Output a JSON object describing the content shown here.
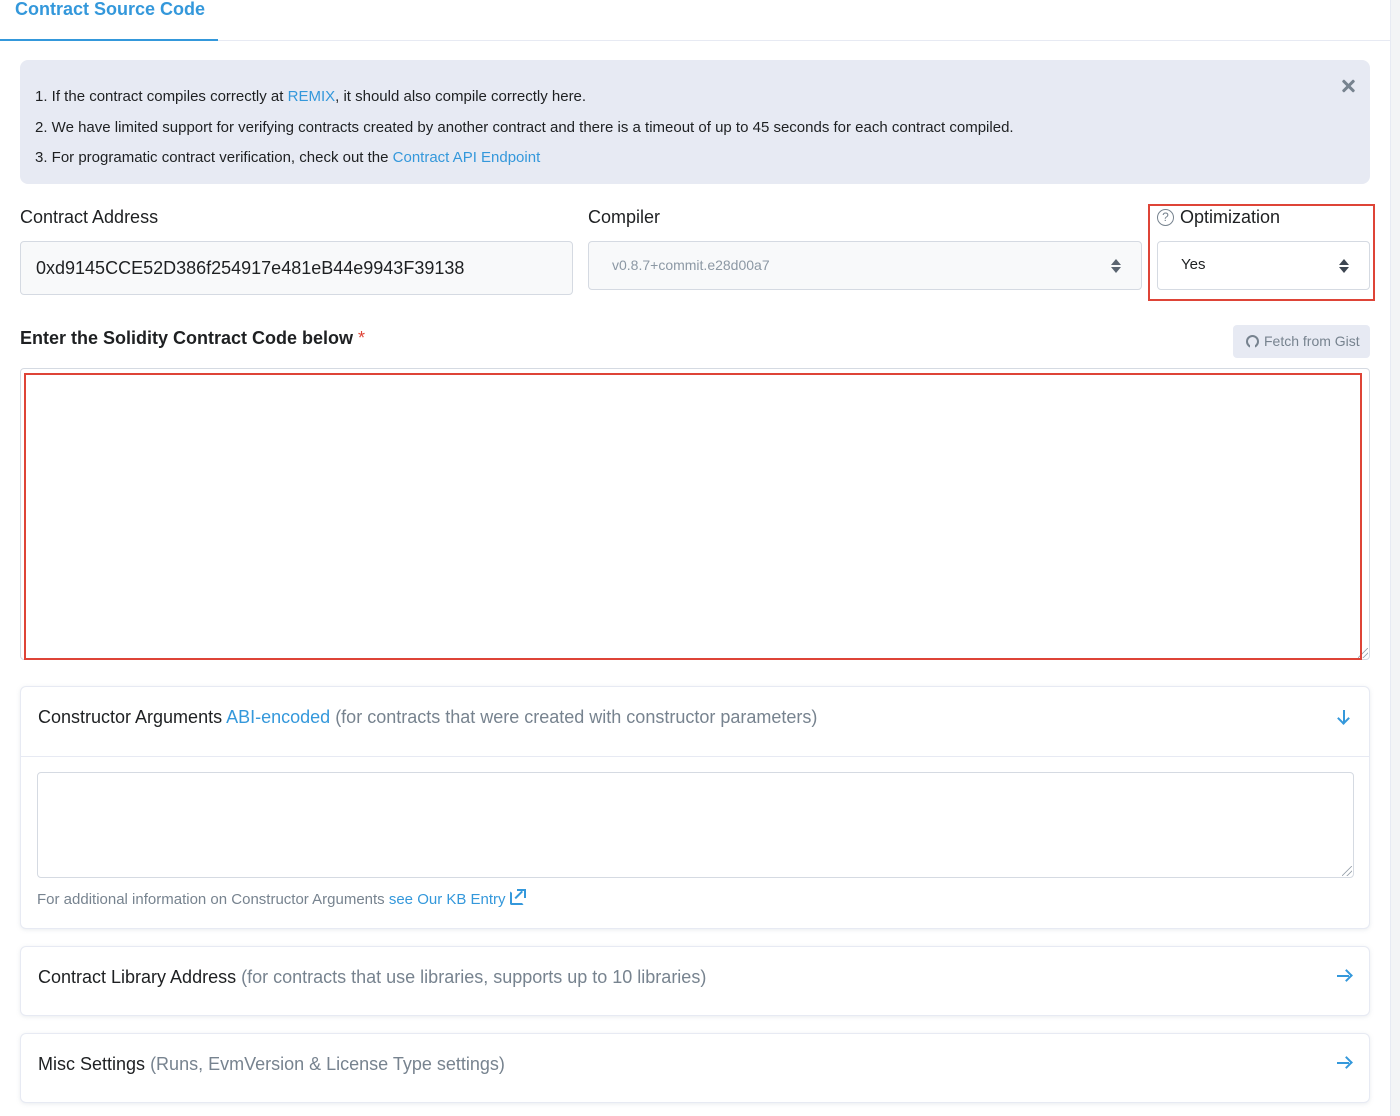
{
  "tabs": {
    "active_label": "Contract Source Code"
  },
  "alert": {
    "line1_prefix": "1. If the contract compiles correctly at ",
    "line1_link": "REMIX",
    "line1_suffix": ", it should also compile correctly here.",
    "line2": "2. We have limited support for verifying contracts created by another contract and there is a timeout of up to 45 seconds for each contract compiled.",
    "line3_prefix": "3. For programatic contract verification, check out the ",
    "line3_link": "Contract API Endpoint",
    "close_icon": "close-icon"
  },
  "form": {
    "address_label": "Contract Address",
    "address_value": "0xd9145CCE52D386f254917e481eB44e9943F39138",
    "compiler_label": "Compiler",
    "compiler_value": "v0.8.7+commit.e28d00a7",
    "optimization_label": "Optimization",
    "optimization_help_glyph": "?",
    "optimization_value": "Yes"
  },
  "code": {
    "heading": "Enter the Solidity Contract Code below",
    "required_mark": "*",
    "fetch_button": "Fetch from Gist",
    "value": ""
  },
  "constructor_args": {
    "title": "Constructor Arguments",
    "link": "ABI-encoded",
    "subtitle": "(for contracts that were created with constructor parameters)",
    "note_prefix": "For additional information on Constructor Arguments ",
    "note_link": "see Our KB Entry",
    "value": ""
  },
  "library": {
    "title": "Contract Library Address",
    "subtitle": "(for contracts that use libraries, supports up to 10 libraries)"
  },
  "misc": {
    "title": "Misc Settings",
    "subtitle": "(Runs, EvmVersion & License Type settings)"
  },
  "colors": {
    "accent": "#3498db",
    "highlight": "#de4437",
    "alert_bg": "#e7eaf3",
    "muted_text": "#77838f"
  }
}
